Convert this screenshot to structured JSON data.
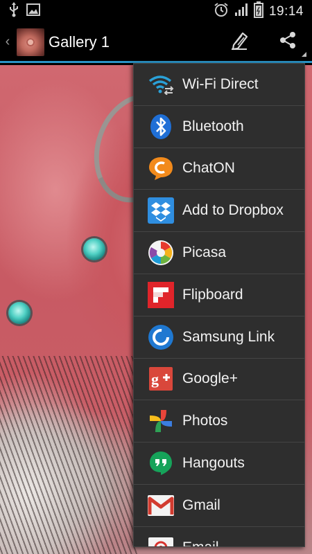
{
  "status_bar": {
    "time": "19:14",
    "left_icons": [
      "usb-icon",
      "image-notification-icon"
    ],
    "right_icons": [
      "alarm-icon",
      "signal-icon",
      "battery-icon"
    ]
  },
  "action_bar": {
    "title": "Gallery 1",
    "accent_color": "#2a93c6",
    "actions": [
      {
        "name": "edit-pencil-icon"
      },
      {
        "name": "share-icon"
      }
    ]
  },
  "share_menu": {
    "items": [
      {
        "label": "Wi-Fi Direct",
        "icon": "wifi-direct-icon"
      },
      {
        "label": "Bluetooth",
        "icon": "bluetooth-icon"
      },
      {
        "label": "ChatON",
        "icon": "chaton-icon"
      },
      {
        "label": "Add to Dropbox",
        "icon": "dropbox-icon"
      },
      {
        "label": "Picasa",
        "icon": "picasa-icon"
      },
      {
        "label": "Flipboard",
        "icon": "flipboard-icon"
      },
      {
        "label": "Samsung Link",
        "icon": "samsung-link-icon"
      },
      {
        "label": "Google+",
        "icon": "google-plus-icon"
      },
      {
        "label": "Photos",
        "icon": "google-photos-icon"
      },
      {
        "label": "Hangouts",
        "icon": "hangouts-icon"
      },
      {
        "label": "Gmail",
        "icon": "gmail-icon"
      },
      {
        "label": "Email",
        "icon": "email-icon"
      }
    ]
  }
}
